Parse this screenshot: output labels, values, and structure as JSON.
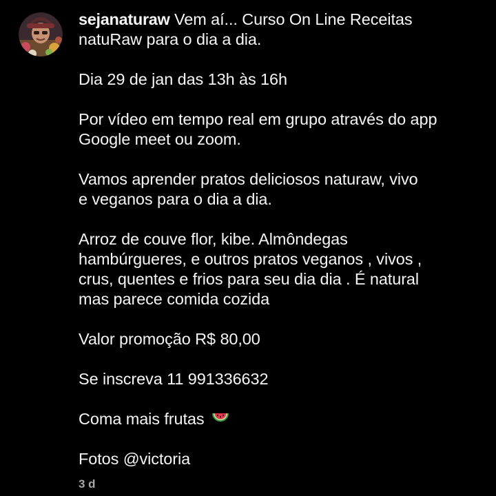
{
  "post": {
    "avatar_icon": "profile-avatar",
    "username": "sejanaturaw",
    "caption_line_1_rest": " Vem aí... Curso On Line Receitas",
    "caption_line_2": "natuRaw para o dia a dia.",
    "date_line": "Dia 29 de jan das 13h às 16h",
    "video_line_1": "Por vídeo em tempo real em grupo através do app",
    "video_line_2": "Google meet ou zoom.",
    "learn_line_1": "Vamos aprender pratos deliciosos naturaw,  vivo",
    "learn_line_2": "e veganos para o dia a dia.",
    "dishes_line_1": "Arroz de couve flor, kibe. Almôndegas",
    "dishes_line_2": "hambúrgueres,  e outros pratos veganos , vivos ,",
    "dishes_line_3": "crus, quentes e frios para seu dia dia . É  natural",
    "dishes_line_4": "mas parece comida cozida",
    "price_line": "Valor promoção R$ 80,00",
    "signup_line": "Se inscreva 11 991336632",
    "fruits_line": "Coma mais frutas",
    "fruits_icon": "watermelon-emoji",
    "photos_prefix": "Fotos ",
    "photos_mention": "@victoria",
    "timestamp": "3 d"
  }
}
